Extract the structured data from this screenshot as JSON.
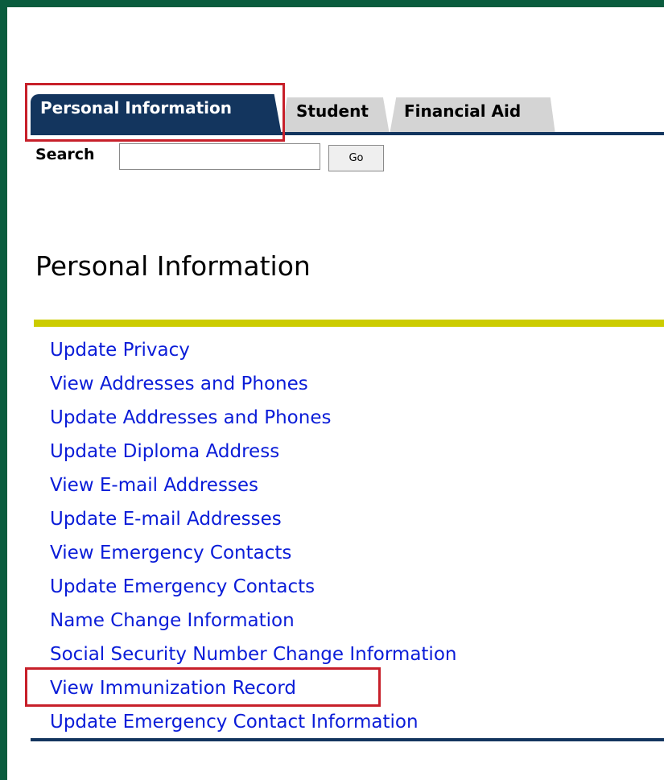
{
  "tabs": [
    {
      "label": "Personal Information",
      "active": true
    },
    {
      "label": "Student",
      "active": false
    },
    {
      "label": "Financial Aid",
      "active": false
    }
  ],
  "search": {
    "label": "Search",
    "value": "",
    "button_label": "Go"
  },
  "page_title": "Personal Information",
  "links": [
    "Update Privacy",
    "View Addresses and Phones",
    "Update Addresses and Phones",
    "Update Diploma Address",
    "View E-mail Addresses",
    "Update E-mail Addresses",
    "View Emergency Contacts",
    "Update Emergency Contacts",
    "Name Change Information",
    "Social Security Number Change Information",
    "View Immunization Record",
    "Update Emergency Contact Information"
  ],
  "colors": {
    "frame": "#0a5c3e",
    "tab_active": "#13355e",
    "tab_inactive": "#d4d4d4",
    "link": "#0a1cd8",
    "title_rule": "#cccc00",
    "highlight": "#c7202a"
  }
}
